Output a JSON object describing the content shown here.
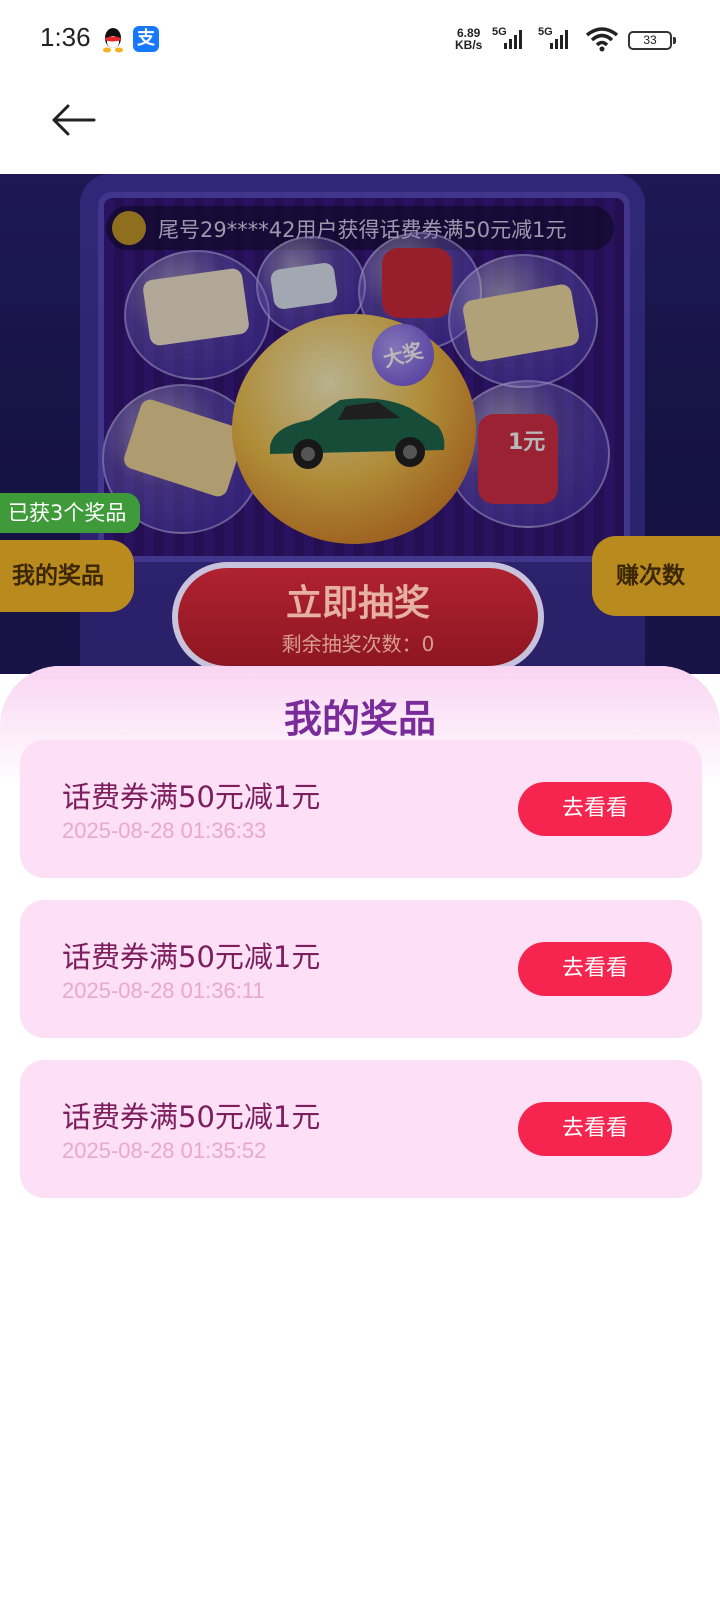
{
  "status_bar": {
    "time": "1:36",
    "net_speed_value": "6.89",
    "net_speed_unit": "KB/s",
    "signal1_label": "5G",
    "signal2_label": "5G",
    "battery": "33",
    "icons": [
      "qq-icon",
      "alipay-icon",
      "signal-icon",
      "wifi-icon",
      "battery-icon"
    ]
  },
  "alipay_glyph": "支",
  "hero": {
    "ticker_text": "尾号29****42用户获得话费券满50元减1元",
    "big_prize_badge": "大奖",
    "badge_1yuan": "1元",
    "prize_count_tag": "已获3个奖品",
    "my_prizes_tab": "我的奖品",
    "earn_tab": "赚次数",
    "draw_button": {
      "label": "立即抽奖",
      "remaining": "剩余抽奖次数：0"
    }
  },
  "sheet": {
    "title": "我的奖品",
    "prizes": [
      {
        "name": "话费券满50元减1元",
        "time": "2025-08-28 01:36:33",
        "action": "去看看"
      },
      {
        "name": "话费券满50元减1元",
        "time": "2025-08-28 01:36:11",
        "action": "去看看"
      },
      {
        "name": "话费券满50元减1元",
        "time": "2025-08-28 01:35:52",
        "action": "去看看"
      }
    ]
  },
  "colors": {
    "accent_button": "#f5254f",
    "card_bg": "#fde0f5",
    "title_purple": "#7a2b9a",
    "prize_text": "#7d1f5e"
  }
}
